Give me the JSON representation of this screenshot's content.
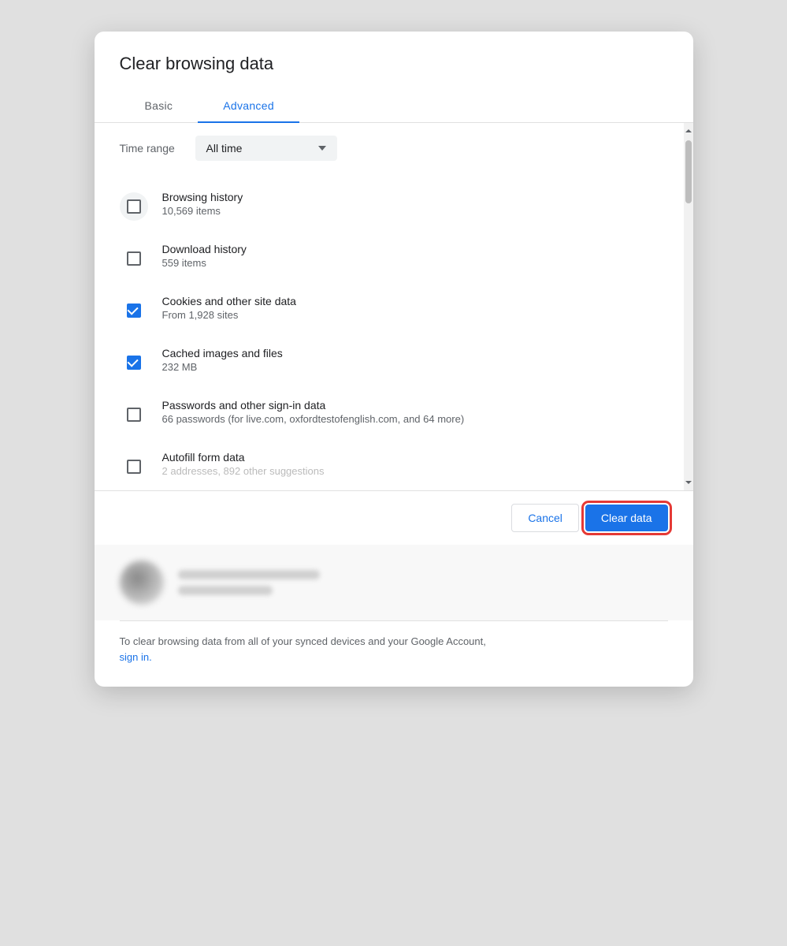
{
  "dialog": {
    "title": "Clear browsing data",
    "tabs": [
      {
        "id": "basic",
        "label": "Basic",
        "active": false
      },
      {
        "id": "advanced",
        "label": "Advanced",
        "active": true
      }
    ],
    "time_range": {
      "label": "Time range",
      "value": "All time"
    },
    "items": [
      {
        "id": "browsing-history",
        "title": "Browsing history",
        "subtitle": "10,569 items",
        "checked": false,
        "hovered": true
      },
      {
        "id": "download-history",
        "title": "Download history",
        "subtitle": "559 items",
        "checked": false,
        "hovered": false
      },
      {
        "id": "cookies",
        "title": "Cookies and other site data",
        "subtitle": "From 1,928 sites",
        "checked": true,
        "hovered": false
      },
      {
        "id": "cached",
        "title": "Cached images and files",
        "subtitle": "232 MB",
        "checked": true,
        "hovered": false
      },
      {
        "id": "passwords",
        "title": "Passwords and other sign-in data",
        "subtitle": "66 passwords (for live.com, oxfordtestofenglish.com, and 64 more)",
        "checked": false,
        "hovered": false
      },
      {
        "id": "autofill",
        "title": "Autofill form data",
        "subtitle": "2 addresses, 892 other suggestions",
        "checked": false,
        "hovered": false
      }
    ],
    "footer": {
      "cancel_label": "Cancel",
      "clear_label": "Clear data"
    },
    "signin_text": "To clear browsing data from all of your synced devices and your Google Account,",
    "signin_link": "sign in."
  }
}
